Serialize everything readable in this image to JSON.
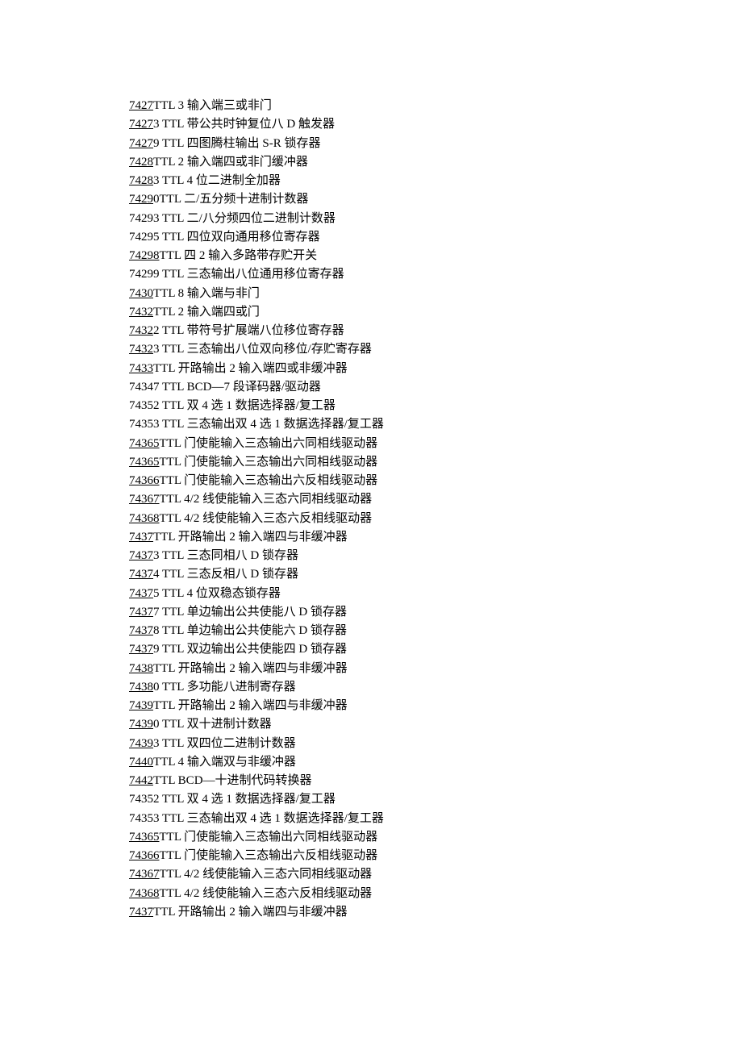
{
  "lines": [
    {
      "link": "7427",
      "text": "TTL 3 输入端三或非门"
    },
    {
      "link": "7427",
      "text": "3 TTL  带公共时钟复位八 D 触发器"
    },
    {
      "link": "7427",
      "text": "9 TTL  四图腾柱输出 S-R 锁存器"
    },
    {
      "link": "7428",
      "text": "TTL 2 输入端四或非门缓冲器"
    },
    {
      "link": "7428",
      "text": "3 TTL 4 位二进制全加器"
    },
    {
      "link": "7429",
      "text": "0TTL  二/五分频十进制计数器"
    },
    {
      "link": null,
      "text": "74293 TTL  二/八分频四位二进制计数器"
    },
    {
      "link": null,
      "text": "74295 TTL  四位双向通用移位寄存器"
    },
    {
      "link": "74298",
      "text": "TTL  四 2 输入多路带存贮开关"
    },
    {
      "link": null,
      "text": "74299 TTL  三态输出八位通用移位寄存器"
    },
    {
      "link": "7430",
      "text": "TTL 8 输入端与非门"
    },
    {
      "link": "7432",
      "text": "TTL 2 输入端四或门"
    },
    {
      "link": "7432",
      "text": "2 TTL  带符号扩展端八位移位寄存器"
    },
    {
      "link": "7432",
      "text": "3 TTL  三态输出八位双向移位/存贮寄存器"
    },
    {
      "link": "7433",
      "text": "TTL  开路输出 2 输入端四或非缓冲器"
    },
    {
      "link": null,
      "text": "74347 TTL BCD—7 段译码器/驱动器"
    },
    {
      "link": null,
      "text": "74352 TTL  双 4 选 1 数据选择器/复工器"
    },
    {
      "link": null,
      "text": "74353 TTL  三态输出双 4 选 1 数据选择器/复工器"
    },
    {
      "link": "74365",
      "text": "TTL  门使能输入三态输出六同相线驱动器"
    },
    {
      "link": "74365",
      "text": "TTL  门使能输入三态输出六同相线驱动器"
    },
    {
      "link": "74366",
      "text": "TTL  门使能输入三态输出六反相线驱动器"
    },
    {
      "link": "74367",
      "text": "TTL 4/2 线使能输入三态六同相线驱动器"
    },
    {
      "link": "74368",
      "text": "TTL 4/2 线使能输入三态六反相线驱动器"
    },
    {
      "link": "7437",
      "text": "TTL  开路输出 2 输入端四与非缓冲器"
    },
    {
      "link": "7437",
      "text": "3 TTL  三态同相八 D 锁存器"
    },
    {
      "link": "7437",
      "text": "4 TTL  三态反相八 D 锁存器"
    },
    {
      "link": "7437",
      "text": "5 TTL 4 位双稳态锁存器"
    },
    {
      "link": "7437",
      "text": "7 TTL  单边输出公共使能八 D 锁存器"
    },
    {
      "link": "7437",
      "text": "8 TTL  单边输出公共使能六 D 锁存器"
    },
    {
      "link": "7437",
      "text": "9 TTL  双边输出公共使能四 D 锁存器"
    },
    {
      "link": "7438",
      "text": "TTL  开路输出 2 输入端四与非缓冲器"
    },
    {
      "link": "7438",
      "text": "0 TTL  多功能八进制寄存器"
    },
    {
      "link": "7439",
      "text": "TTL  开路输出 2 输入端四与非缓冲器"
    },
    {
      "link": "7439",
      "text": "0 TTL  双十进制计数器"
    },
    {
      "link": "7439",
      "text": "3 TTL  双四位二进制计数器"
    },
    {
      "link": "7440",
      "text": "TTL 4 输入端双与非缓冲器"
    },
    {
      "link": "7442",
      "text": "TTL BCD—十进制代码转换器"
    },
    {
      "link": null,
      "text": "74352 TTL  双 4 选 1 数据选择器/复工器"
    },
    {
      "link": null,
      "text": "74353 TTL  三态输出双 4 选 1 数据选择器/复工器"
    },
    {
      "link": "74365",
      "text": "TTL  门使能输入三态输出六同相线驱动器"
    },
    {
      "link": "74366",
      "text": "TTL  门使能输入三态输出六反相线驱动器"
    },
    {
      "link": "74367",
      "text": "TTL 4/2 线使能输入三态六同相线驱动器"
    },
    {
      "link": "74368",
      "text": "TTL 4/2 线使能输入三态六反相线驱动器"
    },
    {
      "link": "7437",
      "text": "TTL  开路输出 2 输入端四与非缓冲器"
    }
  ]
}
